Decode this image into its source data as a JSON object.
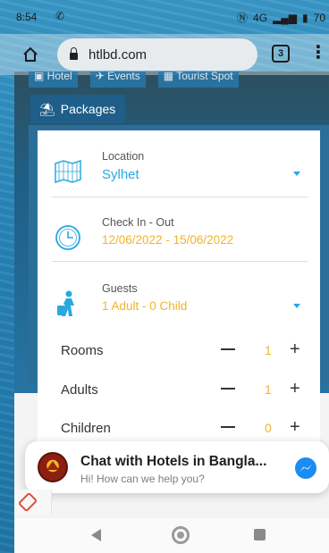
{
  "status_bar": {
    "time": "8:54",
    "left_icon": "wifi-calling-icon",
    "network": "4G",
    "battery": "70"
  },
  "browser": {
    "url": "htlbd.com",
    "tab_count": "3"
  },
  "nav_tabs": [
    {
      "label": "Hotel",
      "icon": "hotel-icon"
    },
    {
      "label": "Events",
      "icon": "plane-icon"
    },
    {
      "label": "Tourist Spot",
      "icon": "map-icon"
    }
  ],
  "packages_tab": {
    "label": "Packages",
    "icon": "packages-icon"
  },
  "search": {
    "location": {
      "label": "Location",
      "value": "Sylhet"
    },
    "checkin": {
      "label": "Check In - Out",
      "value": "12/06/2022 - 15/06/2022"
    },
    "guests": {
      "label": "Guests",
      "value": "1 Adult - 0 Child"
    }
  },
  "counters": [
    {
      "label": "Rooms",
      "value": "1"
    },
    {
      "label": "Adults",
      "value": "1"
    },
    {
      "label": "Children",
      "value": "0"
    }
  ],
  "chat": {
    "title": "Chat with Hotels in Bangla...",
    "subtitle": "Hi! How can we help you?"
  },
  "colors": {
    "accent_blue": "#29a8e0",
    "accent_yellow": "#f0b429",
    "hero_blue": "#2b6f98"
  }
}
